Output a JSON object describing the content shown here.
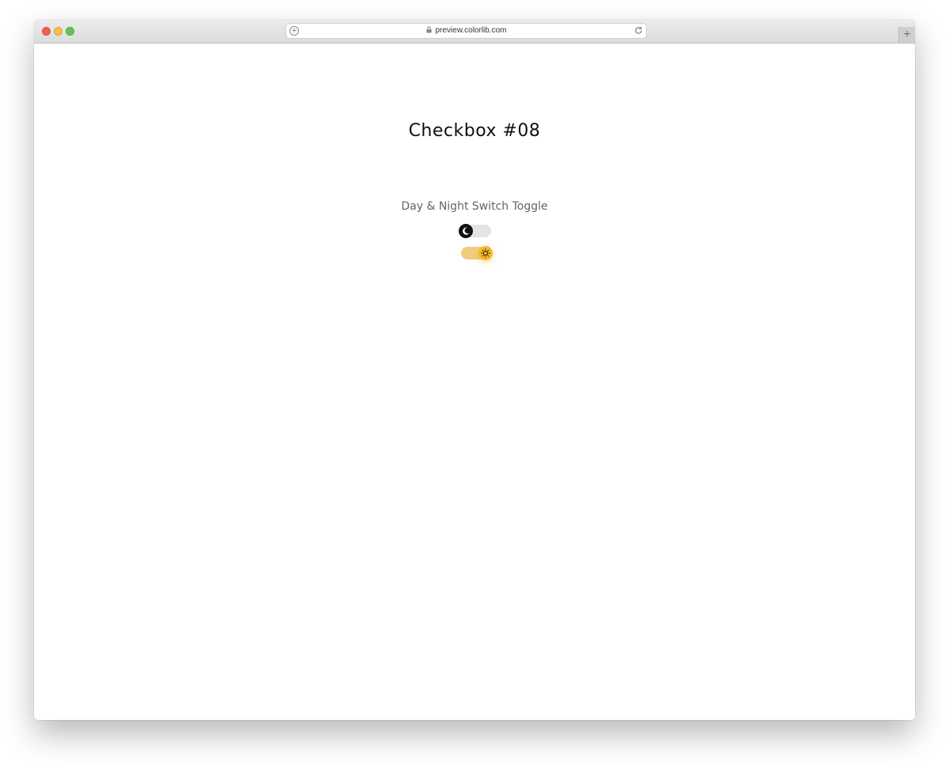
{
  "browser": {
    "url": "preview.colorlib.com",
    "new_tab_label": "+"
  },
  "page": {
    "title": "Checkbox #08",
    "subtitle": "Day & Night Switch Toggle"
  },
  "toggles": [
    {
      "mode": "night",
      "checked": false,
      "icon": "moon-icon"
    },
    {
      "mode": "day",
      "checked": true,
      "icon": "sun-icon"
    }
  ],
  "colors": {
    "accent_day": "#f5b92b",
    "track_day": "#f0cd7a",
    "track_night": "#e4e4e4",
    "knob_night": "#111111"
  }
}
